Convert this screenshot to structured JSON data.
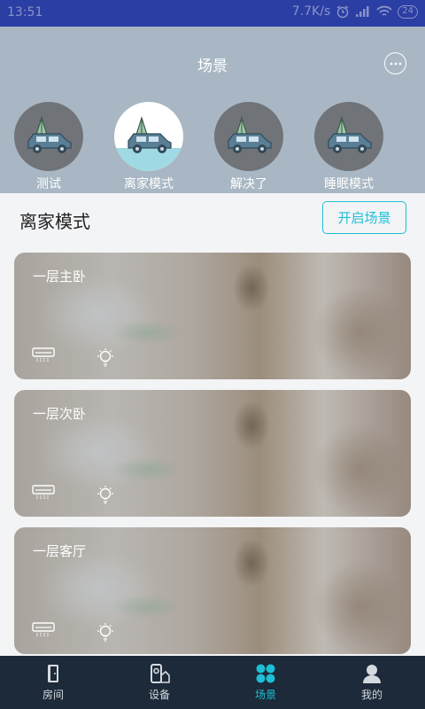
{
  "status_bar": {
    "time": "13:51",
    "speed": "7.7K/s",
    "battery": "24"
  },
  "header": {
    "title": "场景"
  },
  "scenes": [
    {
      "label": "测试",
      "active": false
    },
    {
      "label": "离家模式",
      "active": true
    },
    {
      "label": "解决了",
      "active": false
    },
    {
      "label": "睡眠模式",
      "active": false
    }
  ],
  "mode": {
    "title": "离家模式",
    "start_label": "开启场景"
  },
  "rooms": [
    {
      "name": "一层主卧"
    },
    {
      "name": "一层次卧"
    },
    {
      "name": "一层客厅"
    }
  ],
  "tabs": [
    {
      "label": "房间",
      "icon": "door-icon"
    },
    {
      "label": "设备",
      "icon": "device-icon"
    },
    {
      "label": "场景",
      "icon": "scene-icon",
      "active": true
    },
    {
      "label": "我的",
      "icon": "user-icon"
    }
  ],
  "colors": {
    "accent": "#1dbfd6",
    "header_bg": "#a8b7c3",
    "tabbar_bg": "#1c2a39",
    "statusbar_bg": "#2a3ea3"
  }
}
